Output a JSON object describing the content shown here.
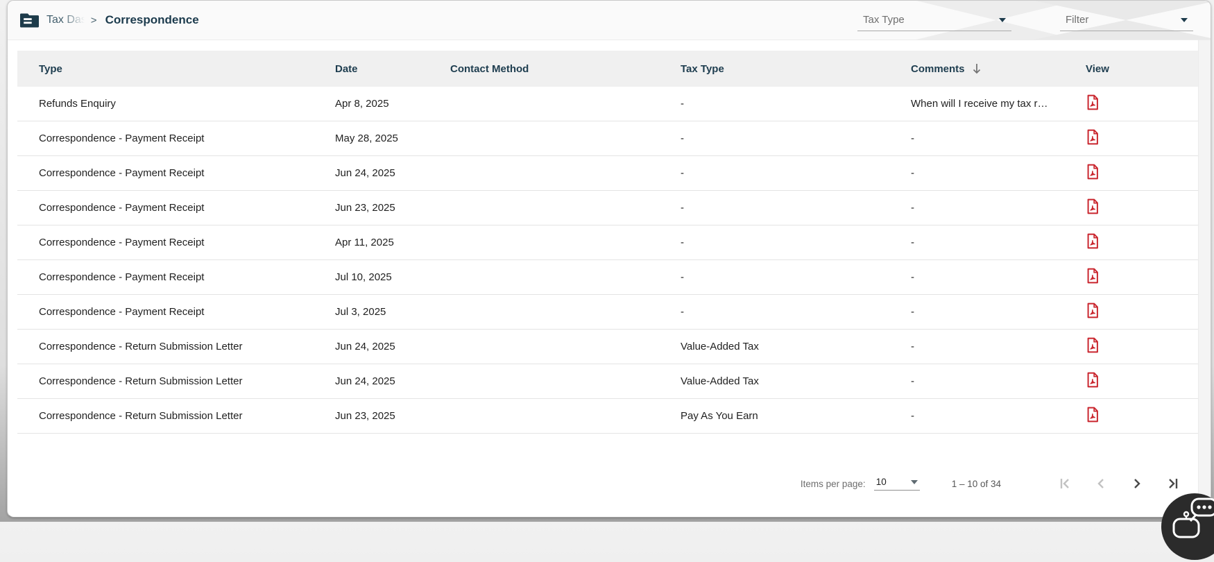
{
  "breadcrumb": {
    "root_label": "Tax Das",
    "separator": ">",
    "current_label": "Correspondence"
  },
  "topbar_filters": {
    "tax_type_label": "Tax Type",
    "filter_label": "Filter"
  },
  "table": {
    "columns": [
      {
        "key": "type",
        "label": "Type"
      },
      {
        "key": "date",
        "label": "Date"
      },
      {
        "key": "contact_method",
        "label": "Contact Method"
      },
      {
        "key": "tax_type",
        "label": "Tax Type"
      },
      {
        "key": "comments",
        "label": "Comments",
        "sorted": "desc"
      },
      {
        "key": "view",
        "label": "View"
      }
    ],
    "rows": [
      {
        "type": "Refunds Enquiry",
        "date": "Apr 8, 2025",
        "contact_method": "",
        "tax_type": "-",
        "comments": "When will I receive my tax r…",
        "view": "pdf"
      },
      {
        "type": "Correspondence - Payment Receipt",
        "date": "May 28, 2025",
        "contact_method": "",
        "tax_type": "-",
        "comments": "-",
        "view": "pdf"
      },
      {
        "type": "Correspondence - Payment Receipt",
        "date": "Jun 24, 2025",
        "contact_method": "",
        "tax_type": "-",
        "comments": "-",
        "view": "pdf"
      },
      {
        "type": "Correspondence - Payment Receipt",
        "date": "Jun 23, 2025",
        "contact_method": "",
        "tax_type": "-",
        "comments": "-",
        "view": "pdf"
      },
      {
        "type": "Correspondence - Payment Receipt",
        "date": "Apr 11, 2025",
        "contact_method": "",
        "tax_type": "-",
        "comments": "-",
        "view": "pdf"
      },
      {
        "type": "Correspondence - Payment Receipt",
        "date": "Jul 10, 2025",
        "contact_method": "",
        "tax_type": "-",
        "comments": "-",
        "view": "pdf"
      },
      {
        "type": "Correspondence - Payment Receipt",
        "date": "Jul 3, 2025",
        "contact_method": "",
        "tax_type": "-",
        "comments": "-",
        "view": "pdf"
      },
      {
        "type": "Correspondence - Return Submission Letter",
        "date": "Jun 24, 2025",
        "contact_method": "",
        "tax_type": "Value-Added Tax",
        "comments": "-",
        "view": "pdf"
      },
      {
        "type": "Correspondence - Return Submission Letter",
        "date": "Jun 24, 2025",
        "contact_method": "",
        "tax_type": "Value-Added Tax",
        "comments": "-",
        "view": "pdf"
      },
      {
        "type": "Correspondence - Return Submission Letter",
        "date": "Jun 23, 2025",
        "contact_method": "",
        "tax_type": "Pay As You Earn",
        "comments": "-",
        "view": "pdf"
      }
    ]
  },
  "pagination": {
    "items_per_page_label": "Items per page:",
    "items_per_page_value": "10",
    "range_label": "1 – 10 of 34",
    "first_enabled": false,
    "prev_enabled": false,
    "next_enabled": true,
    "last_enabled": true
  },
  "icons": {
    "breadcrumb_icon": "folder-icon",
    "sort_icon": "arrow-down-icon",
    "view_icon": "pdf-icon",
    "assistant_icon": "chat-bot-icon"
  },
  "colors": {
    "accent_teal": "#1d3b4c",
    "pdf_red": "#c9252d",
    "header_bg": "#f0f0f0",
    "topbar_bg": "#fafafa"
  }
}
